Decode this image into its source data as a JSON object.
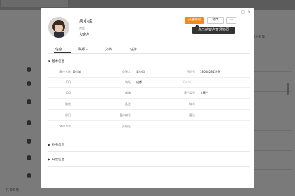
{
  "background": {
    "tab_label": "客户管理",
    "right_header": "客户数量",
    "bottom_text": "共 98 条"
  },
  "modal": {
    "window_controls": {
      "restore": "◻",
      "close": "×"
    },
    "customer": {
      "name": "吴小姐",
      "tag_label": "类型",
      "tag_value": "大客户"
    },
    "buttons": {
      "open_ticket": "开通协同",
      "edit": "修改",
      "more": "···"
    },
    "tooltip": "点击给客户开通协同",
    "tabs": [
      "信息",
      "联系人",
      "文档",
      "任务"
    ],
    "sections": {
      "basic": "基本信息",
      "business": "业务信息",
      "invoice": "开票信息"
    },
    "fields": [
      {
        "l1": "客户名称",
        "v1": "吴小姐",
        "l2": "负责人",
        "v2": "吴小姐",
        "l3": "手机号",
        "v3": "18048284299"
      },
      {
        "l1": "QQ",
        "v1": "",
        "l2": "地址",
        "v2": "成都",
        "l3": "Email",
        "v3": ""
      },
      {
        "l1": "QQ",
        "v1": "",
        "l2": "邮箱",
        "v2": "",
        "l3": "客户类型",
        "v3": "大客户"
      },
      {
        "l1": "微信",
        "v1": "",
        "l2": "备注",
        "v2": "",
        "l3": "城市",
        "v3": ""
      },
      {
        "l1": "部门",
        "v1": "",
        "l2": "客户编号",
        "v2": "",
        "l3": "备注",
        "v3": ""
      },
      {
        "l1": "WeChat",
        "v1": "",
        "l2": "身份证",
        "v2": "",
        "l3": "",
        "v3": ""
      }
    ]
  }
}
